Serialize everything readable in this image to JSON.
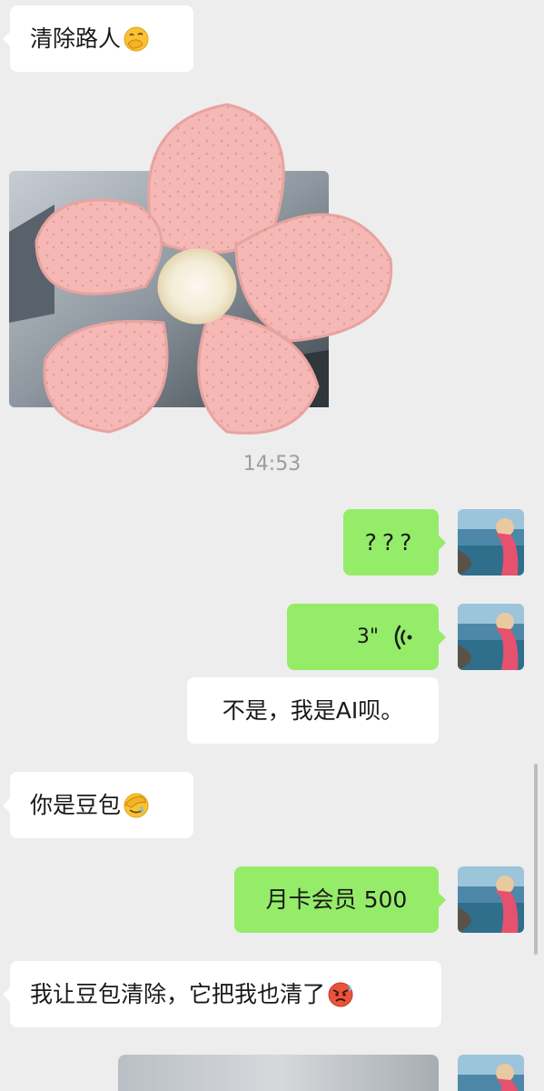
{
  "messages": {
    "m1": {
      "text": "清除路人",
      "emoji": "hand-over-mouth-emoji"
    },
    "sticker": {
      "description": "pink-flower-sticker"
    },
    "timestamp": "14:53",
    "m2": {
      "text": "???"
    },
    "m3": {
      "duration": "3\""
    },
    "m4": {
      "text": "不是，我是AI呗。"
    },
    "m5": {
      "text": "你是豆包",
      "emoji": "face-palm-emoji"
    },
    "m6": {
      "text": "月卡会员 500"
    },
    "m7": {
      "text": "我让豆包清除，它把我也清了",
      "emoji": "angry-face-emoji"
    }
  },
  "colors": {
    "background": "#ededed",
    "incoming_bubble": "#ffffff",
    "outgoing_bubble": "#95ec69",
    "text": "#191919",
    "timestamp": "#9c9c9c"
  }
}
